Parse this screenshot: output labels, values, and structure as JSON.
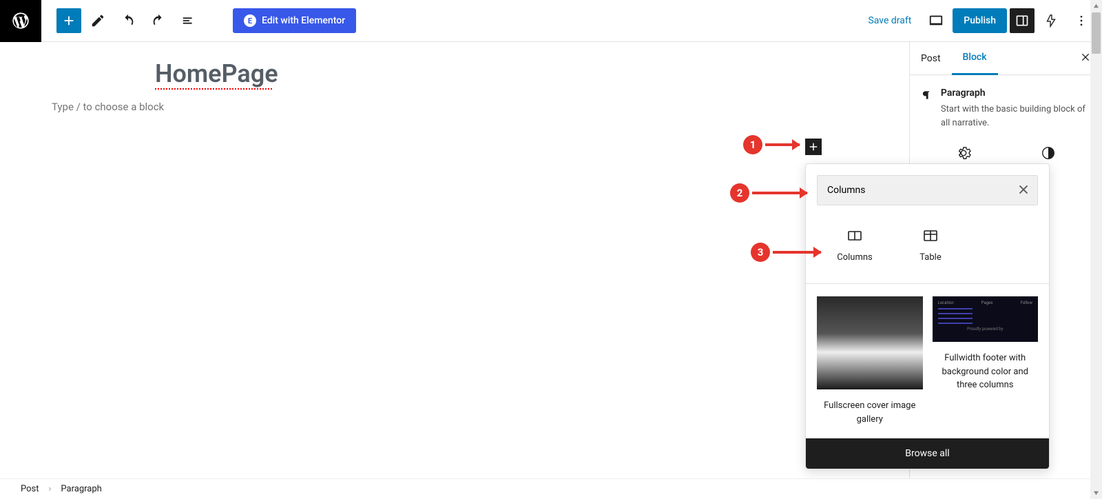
{
  "topbar": {
    "elementor_btn": "Edit with Elementor",
    "save_draft": "Save draft",
    "publish": "Publish"
  },
  "canvas": {
    "title": "HomePage",
    "paragraph_placeholder": "Type / to choose a block"
  },
  "sidebar": {
    "tabs": {
      "post": "Post",
      "block": "Block"
    },
    "block_type_title": "Paragraph",
    "block_type_desc": "Start with the basic building block of all narrative."
  },
  "inserter": {
    "search_value": "Columns",
    "blocks": [
      {
        "name": "Columns"
      },
      {
        "name": "Table"
      }
    ],
    "patterns": [
      {
        "caption": "Fullscreen cover image gallery"
      },
      {
        "caption": "Fullwidth footer with background color and three columns"
      }
    ],
    "footer": "Browse all"
  },
  "breadcrumb": {
    "root": "Post",
    "current": "Paragraph"
  },
  "annotations": {
    "a1": "1",
    "a2": "2",
    "a3": "3"
  }
}
